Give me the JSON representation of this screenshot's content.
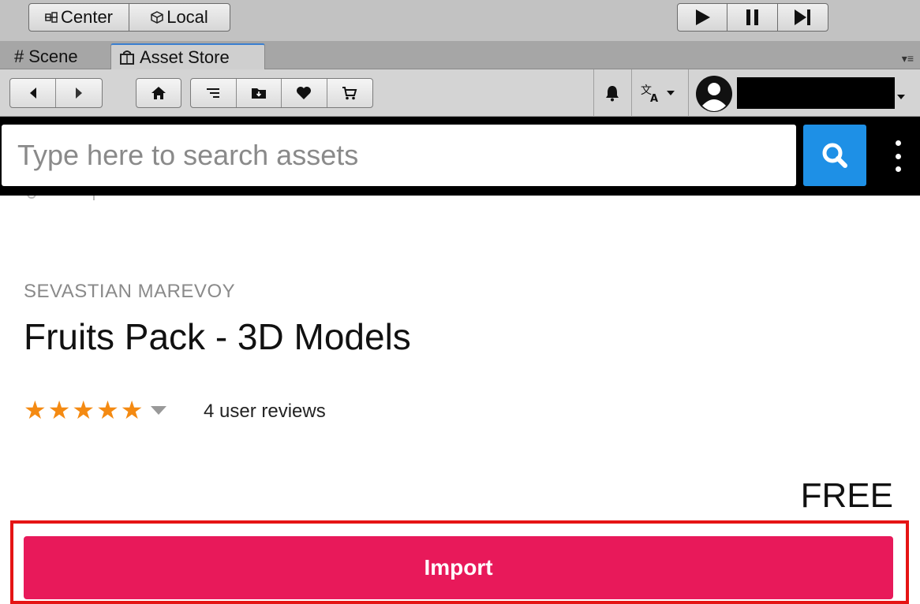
{
  "editor_toolbar": {
    "pivot_label": "Center",
    "space_label": "Local"
  },
  "tabs": [
    {
      "label": "Scene"
    },
    {
      "label": "Asset Store"
    }
  ],
  "search": {
    "placeholder": "Type here to search assets"
  },
  "asset": {
    "publisher": "SEVASTIAN MAREVOY",
    "title": "Fruits Pack - 3D Models",
    "rating_stars": 5,
    "reviews_label": "4 user reviews",
    "price": "FREE",
    "import_label": "Import"
  },
  "colors": {
    "star": "#f48a12",
    "import_button": "#e8195a",
    "search_button": "#1e90e6",
    "highlight_border": "#e51414"
  }
}
